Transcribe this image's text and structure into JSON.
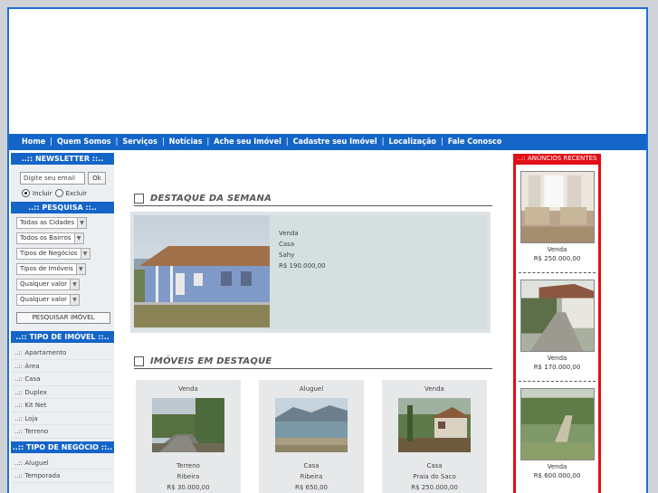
{
  "nav": [
    {
      "label": "Home"
    },
    {
      "label": "Quem Somos"
    },
    {
      "label": "Serviços"
    },
    {
      "label": "Notícias"
    },
    {
      "label": "Ache seu Imóvel"
    },
    {
      "label": "Cadastre seu Imóvel"
    },
    {
      "label": "Localização"
    },
    {
      "label": "Fale Conosco"
    }
  ],
  "newsletter": {
    "title": "..:: NEWSLETTER ::..",
    "placeholder": "Digite seu email",
    "ok": "Ok",
    "incluir": "Incluir",
    "excluir": "Excluir"
  },
  "pesquisa": {
    "title": "..:: PESQUISA ::..",
    "selects": [
      "Todas as Cidades",
      "Todos os Bairros",
      "Tipos de Negócios",
      "Tipos de Imóveis",
      "Qualquer valor",
      "Qualquer valor"
    ],
    "button": "PESQUISAR IMÓVEL"
  },
  "tipo_imovel": {
    "title": "..:: TIPO DE IMÓVEL ::..",
    "items": [
      "..:: Apartamento",
      "..:: Área",
      "..:: Casa",
      "..:: Duplex",
      "..:: Kit Net",
      "..:: Loja",
      "..:: Terreno"
    ]
  },
  "tipo_negocio": {
    "title": "..:: TIPO DE NEGÓCIO ::..",
    "items": [
      "..:: Aluguel",
      "..:: Temporada"
    ]
  },
  "destaque_semana": {
    "title": "DESTAQUE DA SEMANA",
    "negocio": "Venda",
    "tipo": "Casa",
    "bairro": "Sahy",
    "preco": "R$ 190.000,00"
  },
  "imoveis_destaque": {
    "title": "IMÓVEIS EM DESTAQUE",
    "cards": [
      {
        "negocio": "Venda",
        "tipo": "Terreno",
        "bairro": "Ribeira",
        "preco": "R$ 30.000,00"
      },
      {
        "negocio": "Aluguel",
        "tipo": "Casa",
        "bairro": "Ribeira",
        "preco": "R$ 650,00"
      },
      {
        "negocio": "Venda",
        "tipo": "Casa",
        "bairro": "Praia do Saco",
        "preco": "R$ 250.000,00"
      }
    ]
  },
  "recentes": {
    "title": "..:: ANÚNCIOS RECENTES ::..",
    "items": [
      {
        "negocio": "Venda",
        "preco": "R$ 250.000,00"
      },
      {
        "negocio": "Venda",
        "preco": "R$ 170.000,00"
      },
      {
        "negocio": "Venda",
        "preco": "R$ 600.000,00"
      }
    ]
  }
}
